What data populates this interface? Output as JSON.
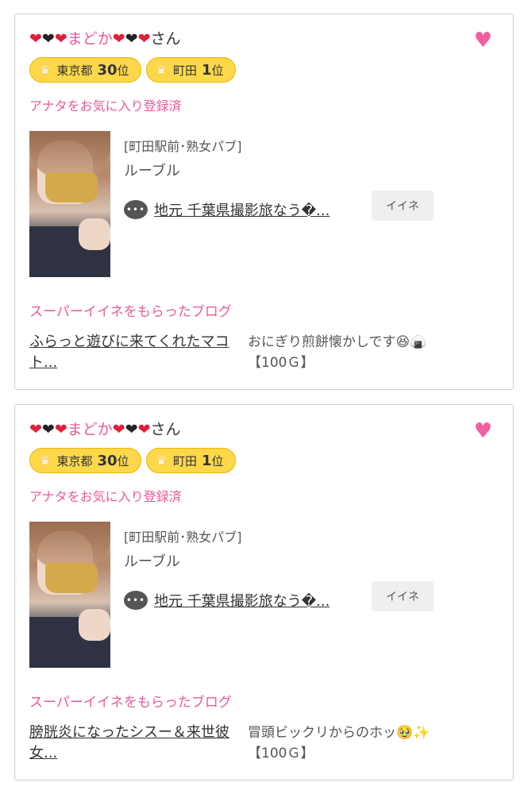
{
  "cards": [
    {
      "name": "まどか",
      "name_suffix": "さん",
      "badges": [
        {
          "area": "東京都",
          "rank": "30",
          "rank_suffix": "位"
        },
        {
          "area": "町田",
          "rank": "1",
          "rank_suffix": "位"
        }
      ],
      "fav_status": "アナタをお気に入り登録済",
      "shop_area": "[町田駅前･熟女パブ]",
      "shop_name": "ルーブル",
      "blog_title": "地元 千葉県撮影旅なう�...",
      "like_label": "イイネ",
      "section_label": "スーパーイイネをもらったブログ",
      "post_link": "ふらっと遊びに来てくれたマコト...",
      "post_comment": "おにぎり煎餅懐かしです😆🍙",
      "post_points": "【100Ｇ】"
    },
    {
      "name": "まどか",
      "name_suffix": "さん",
      "badges": [
        {
          "area": "東京都",
          "rank": "30",
          "rank_suffix": "位"
        },
        {
          "area": "町田",
          "rank": "1",
          "rank_suffix": "位"
        }
      ],
      "fav_status": "アナタをお気に入り登録済",
      "shop_area": "[町田駅前･熟女パブ]",
      "shop_name": "ルーブル",
      "blog_title": "地元 千葉県撮影旅なう�...",
      "like_label": "イイネ",
      "section_label": "スーパーイイネをもらったブログ",
      "post_link": "膀胱炎になったシスー＆来世彼女...",
      "post_comment": "冒頭ビックリからのホッ🥹✨",
      "post_points": "【100Ｇ】"
    }
  ],
  "colors": {
    "accent_pink": "#e85a9b",
    "badge_yellow": "#ffd84a",
    "heart_red": "#e31e3a"
  },
  "icons": [
    "heart-icon",
    "crown-icon",
    "speech-bubble-icon"
  ]
}
